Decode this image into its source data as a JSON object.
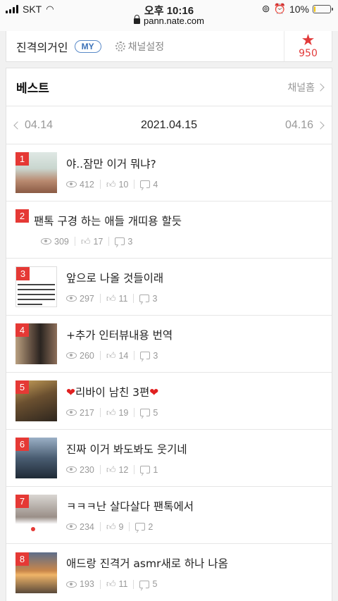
{
  "status": {
    "carrier": "SKT",
    "time": "오후 10:16",
    "battery": "10%",
    "battery_level": 0.1,
    "url": "pann.nate.com"
  },
  "channel": {
    "name": "진격의거인",
    "badge": "MY",
    "settings_label": "채널설정",
    "star_count": "950"
  },
  "best": {
    "title": "베스트",
    "home_label": "채널홈"
  },
  "dates": {
    "prev": "04.14",
    "current": "2021.04.15",
    "next": "04.16"
  },
  "items": [
    {
      "rank": "1",
      "title": "야..잠만 이거 뭐냐?",
      "views": "412",
      "likes": "10",
      "comments": "4"
    },
    {
      "rank": "2",
      "title": "팬톡 구경 하는 애들 개띠용 할듯",
      "views": "309",
      "likes": "17",
      "comments": "3"
    },
    {
      "rank": "3",
      "title": "앞으로 나올 것들이래",
      "views": "297",
      "likes": "11",
      "comments": "3"
    },
    {
      "rank": "4",
      "title": "+추가 인터뷰내용 번역",
      "views": "260",
      "likes": "14",
      "comments": "3"
    },
    {
      "rank": "5",
      "title": "리바이 남친 3편",
      "views": "217",
      "likes": "19",
      "comments": "5"
    },
    {
      "rank": "6",
      "title": "진짜 이거 봐도봐도 웃기네",
      "views": "230",
      "likes": "12",
      "comments": "1"
    },
    {
      "rank": "7",
      "title": "ㅋㅋㅋ난 살다살다 팬톡에서",
      "views": "234",
      "likes": "9",
      "comments": "2"
    },
    {
      "rank": "8",
      "title": "애드랑 진격거 asmr새로 하나 나옴",
      "views": "193",
      "likes": "11",
      "comments": "5"
    }
  ]
}
